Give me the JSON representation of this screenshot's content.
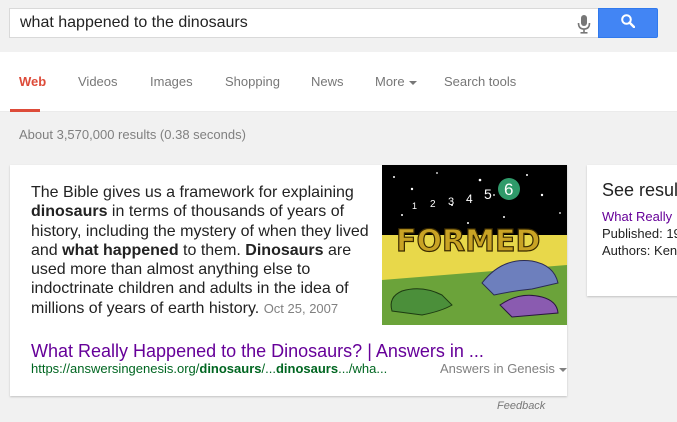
{
  "search": {
    "query": "what happened to the dinosaurs"
  },
  "tabs": [
    {
      "label": "Web"
    },
    {
      "label": "Videos"
    },
    {
      "label": "Images"
    },
    {
      "label": "Shopping"
    },
    {
      "label": "News"
    },
    {
      "label": "More"
    },
    {
      "label": "Search tools"
    }
  ],
  "result_stats": "About 3,570,000 results (0.38 seconds)",
  "answer": {
    "snippet_parts": [
      {
        "text": "The Bible gives us a framework for explaining ",
        "bold": false
      },
      {
        "text": "dinosaurs",
        "bold": true
      },
      {
        "text": " in terms of thousands of years of history, including the mystery of when they lived and ",
        "bold": false
      },
      {
        "text": "what happened",
        "bold": true
      },
      {
        "text": " to them. ",
        "bold": false
      },
      {
        "text": "Dinosaurs",
        "bold": true
      },
      {
        "text": " are used more than almost anything else to indoctrinate children and adults in the idea of millions of years of earth history.",
        "bold": false
      }
    ],
    "date": "Oct 25, 2007",
    "title": "What Really Happened to the Dinosaurs? | Answers in ...",
    "url_parts": [
      {
        "text": "https://answersingenesis.org/",
        "bold": false
      },
      {
        "text": "dinosaurs",
        "bold": true
      },
      {
        "text": "/...",
        "bold": false
      },
      {
        "text": "dinosaurs",
        "bold": true
      },
      {
        "text": ".../wha...",
        "bold": false
      }
    ],
    "source": "Answers in Genesis",
    "image": {
      "word": "FORMED",
      "numbers": [
        "1",
        "2",
        "3",
        "4",
        "5",
        "6"
      ]
    }
  },
  "feedback": "Feedback",
  "knowledge_panel": {
    "title": "See resul",
    "link": "What Really",
    "published": "Published: 19",
    "authors": "Authors: Ken"
  },
  "colors": {
    "accent": "#dd4b39",
    "search_button": "#4285f4",
    "visited_link": "#660099",
    "url_green": "#006621"
  }
}
